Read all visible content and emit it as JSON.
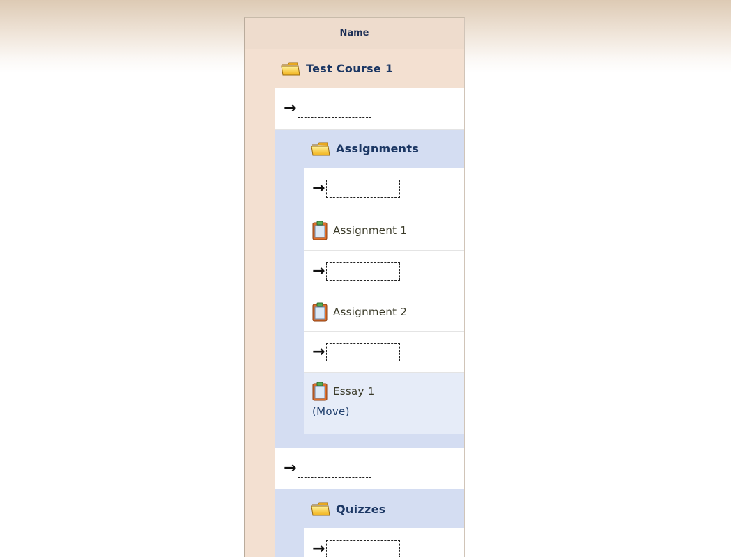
{
  "table": {
    "column_header": "Name"
  },
  "tree": {
    "course": {
      "label": "Test Course 1",
      "icon": "folder-icon"
    },
    "assignments_folder": {
      "label": "Assignments",
      "icon": "folder-icon"
    },
    "items": [
      {
        "label": "Assignment 1",
        "icon": "clipboard-icon"
      },
      {
        "label": "Assignment 2",
        "icon": "clipboard-icon"
      },
      {
        "label": "Essay 1",
        "icon": "clipboard-icon",
        "action": "(Move)"
      }
    ],
    "quizzes_folder": {
      "label": "Quizzes",
      "icon": "folder-icon"
    },
    "drop_target_arrow": "→"
  },
  "colors": {
    "header_band": "#ddcab4",
    "tree_background": "#f3e0d1",
    "folder_panel": "#d4ddf2",
    "selected_item": "#e6ecf8",
    "folder_text": "#1c3764"
  }
}
